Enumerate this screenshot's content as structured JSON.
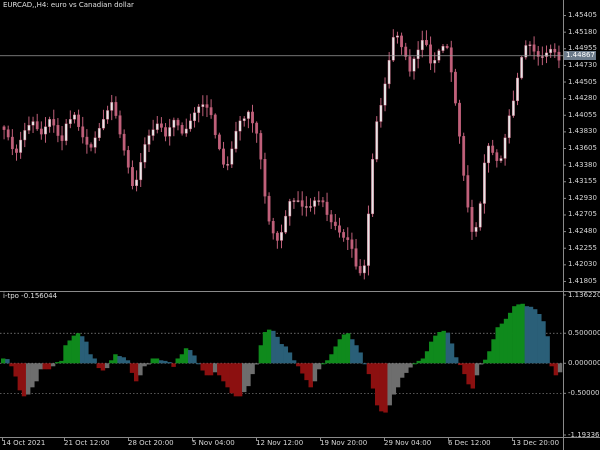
{
  "colors": {
    "background": "#000000",
    "candle": "#c0607a",
    "candle_alt": "#e6e6e6",
    "grid": "#8a8a8a",
    "bid_line": "#9a9a9a",
    "price_tag_bg": "#6b7a8a",
    "hist_green": "#0f8a1c",
    "hist_teal": "#2a5f78",
    "hist_red": "#8c1010",
    "hist_gray": "#6e6e6e"
  },
  "main_panel": {
    "title": "EURCAD,,H4:  euro vs Canadian dollar",
    "current_price": "1.44867",
    "y_labels": [
      "1.45405",
      "1.45180",
      "1.44955",
      "1.44730",
      "1.44505",
      "1.44280",
      "1.44055",
      "1.43830",
      "1.43605",
      "1.43380",
      "1.43155",
      "1.42930",
      "1.42705",
      "1.42480",
      "1.42255",
      "1.42030",
      "1.41805"
    ]
  },
  "indicator_panel": {
    "title": "i-tpo -0.156044",
    "y_labels": [
      "1.136220",
      "0.500000",
      "0.000000",
      "-0.500000",
      "-1.193363"
    ]
  },
  "x_axis": {
    "labels": [
      "14 Oct 2021",
      "21 Oct 12:00",
      "28 Oct 20:00",
      "5 Nov 04:00",
      "12 Nov 12:00",
      "19 Nov 20:00",
      "29 Nov 04:00",
      "6 Dec 12:00",
      "13 Dec 20:00"
    ]
  },
  "chart_data": [
    {
      "type": "candlestick",
      "title": "EURCAD,,H4:  euro vs Canadian dollar",
      "ylim": [
        1.4173,
        1.4548
      ],
      "close": [
        1.4386,
        1.4376,
        1.436,
        1.4355,
        1.4372,
        1.4385,
        1.4392,
        1.4397,
        1.4387,
        1.438,
        1.439,
        1.44,
        1.4392,
        1.4378,
        1.4371,
        1.4394,
        1.44,
        1.4406,
        1.439,
        1.4376,
        1.4366,
        1.4362,
        1.4375,
        1.4388,
        1.44,
        1.4412,
        1.4423,
        1.4405,
        1.438,
        1.4358,
        1.4335,
        1.431,
        1.4318,
        1.4342,
        1.4366,
        1.4378,
        1.4386,
        1.4394,
        1.4389,
        1.4377,
        1.4389,
        1.4399,
        1.4392,
        1.4381,
        1.4387,
        1.4398,
        1.4409,
        1.4417,
        1.442,
        1.4416,
        1.4406,
        1.4379,
        1.436,
        1.4339,
        1.4339,
        1.436,
        1.4384,
        1.4398,
        1.4401,
        1.441,
        1.4395,
        1.4381,
        1.4346,
        1.4296,
        1.4262,
        1.4246,
        1.4236,
        1.4247,
        1.4269,
        1.4289,
        1.429,
        1.429,
        1.4282,
        1.4282,
        1.4282,
        1.429,
        1.429,
        1.4288,
        1.4271,
        1.4261,
        1.4256,
        1.4247,
        1.424,
        1.4237,
        1.4225,
        1.4201,
        1.4192,
        1.4202,
        1.4272,
        1.4346,
        1.4397,
        1.4419,
        1.4448,
        1.448,
        1.4511,
        1.4513,
        1.4498,
        1.4485,
        1.4465,
        1.4482,
        1.4494,
        1.4507,
        1.4501,
        1.4476,
        1.448,
        1.4493,
        1.4499,
        1.4497,
        1.4464,
        1.4422,
        1.4377,
        1.4324,
        1.4281,
        1.4248,
        1.4254,
        1.4286,
        1.4341,
        1.4364,
        1.4355,
        1.4344,
        1.4347,
        1.4375,
        1.4405,
        1.4425,
        1.4456,
        1.4484,
        1.45,
        1.4501,
        1.4492,
        1.4485,
        1.4485,
        1.449,
        1.4495,
        1.4491,
        1.448
      ]
    },
    {
      "type": "bar",
      "title": "i-tpo -0.156044",
      "ylim": [
        -1.193363,
        1.13622
      ],
      "values": [
        0.08,
        0.07,
        -0.05,
        -0.22,
        -0.45,
        -0.55,
        -0.52,
        -0.4,
        -0.3,
        -0.1,
        -0.1,
        -0.1,
        -0.05,
        0.02,
        0.04,
        0.3,
        0.38,
        0.46,
        0.5,
        0.45,
        0.36,
        0.15,
        0.08,
        -0.08,
        -0.12,
        -0.08,
        0.05,
        0.15,
        0.12,
        0.1,
        0.05,
        -0.16,
        -0.3,
        -0.2,
        -0.05,
        -0.02,
        0.08,
        0.08,
        0.05,
        0.04,
        0.02,
        -0.06,
        0.08,
        0.15,
        0.25,
        0.22,
        0.13,
        0.0,
        -0.12,
        -0.2,
        -0.2,
        -0.15,
        -0.2,
        -0.3,
        -0.4,
        -0.5,
        -0.55,
        -0.55,
        -0.48,
        -0.38,
        -0.18,
        -0.02,
        0.3,
        0.52,
        0.56,
        0.54,
        0.44,
        0.32,
        0.28,
        0.18,
        0.05,
        -0.05,
        -0.17,
        -0.28,
        -0.4,
        -0.3,
        -0.1,
        0.0,
        0.05,
        0.15,
        0.28,
        0.4,
        0.48,
        0.5,
        0.4,
        0.3,
        0.18,
        0.0,
        -0.18,
        -0.42,
        -0.7,
        -0.8,
        -0.82,
        -0.7,
        -0.52,
        -0.4,
        -0.24,
        -0.16,
        -0.07,
        0.0,
        0.04,
        0.08,
        0.2,
        0.36,
        0.46,
        0.52,
        0.54,
        0.51,
        0.33,
        0.1,
        -0.03,
        -0.18,
        -0.35,
        -0.42,
        -0.2,
        -0.02,
        0.06,
        0.2,
        0.4,
        0.6,
        0.66,
        0.74,
        0.84,
        0.95,
        0.98,
        0.99,
        0.95,
        0.94,
        0.9,
        0.82,
        0.7,
        0.45,
        -0.05,
        -0.2,
        -0.15
      ]
    }
  ]
}
